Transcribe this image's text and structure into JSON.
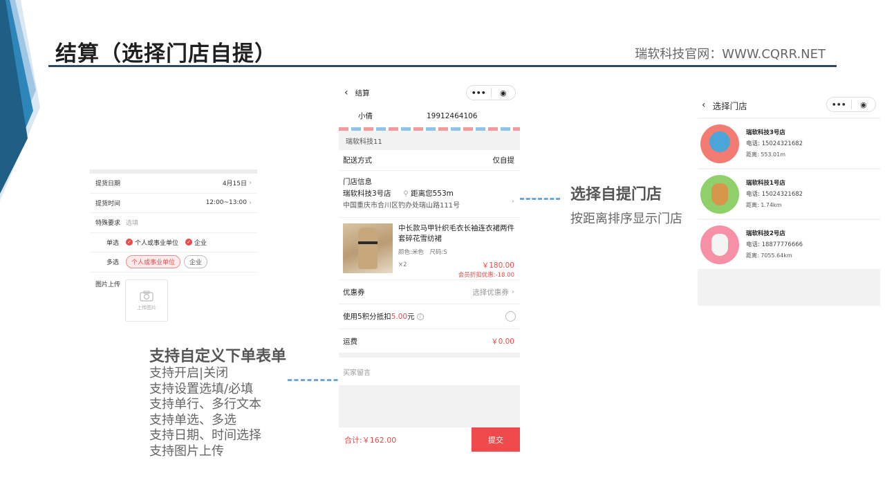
{
  "slide": {
    "title": "结算（选择门店自提）",
    "site": "瑞软科技官网：WWW.CQRR.NET"
  },
  "form": {
    "rows": [
      {
        "label": "提货日期",
        "value": "4月15日"
      },
      {
        "label": "提货时间",
        "value": "12:00~13:00"
      },
      {
        "label": "特殊要求",
        "placeholder": "选填"
      }
    ],
    "single_label": "单选",
    "single_options": [
      "个人或事业单位",
      "企业"
    ],
    "multi_label": "多选",
    "multi_options": [
      "个人或事业单位",
      "企业"
    ],
    "upload_label": "图片上传",
    "upload_hint": "上传图片"
  },
  "features": {
    "heading": "支持自定义下单表单",
    "items": [
      "支持开启|关闭",
      "支持设置选填/必填",
      "支持单行、多行文本",
      "支持单选、多选",
      "支持日期、时间选择",
      "支持图片上传"
    ]
  },
  "checkout": {
    "nav_title": "结算",
    "contact_name": "小倩",
    "contact_phone": "19912464106",
    "shop_name": "瑞软科技11",
    "delivery_label": "配送方式",
    "delivery_value": "仅自提",
    "store_info_label": "门店信息",
    "store_name": "瑞软科技3号店",
    "store_distance": "距离您553m",
    "store_address": "中国重庆市合川区钓办处瑞山路111号",
    "goods_title": "中长款马甲针织毛衣长袖连衣裙两件套碎花雪纺裙",
    "goods_spec": "颜色:米色　尺码:S",
    "goods_qty": "×2",
    "goods_price": "￥180.00",
    "goods_discount": "会员折扣优惠:-18.00",
    "coupon_label": "优惠券",
    "coupon_value": "选择优惠券",
    "points_prefix": "使用5积分抵扣",
    "points_amount": "5.00",
    "points_suffix": "元",
    "shipping_label": "运费",
    "shipping_value": "￥0.00",
    "remark_placeholder": "买家留言",
    "total_label": "合计:",
    "total_value": "￥162.00",
    "submit_label": "提交"
  },
  "store_feature": {
    "heading": "选择自提门店",
    "sub": "按距离排序显示门店"
  },
  "store_list": {
    "nav_title": "选择门店",
    "stores": [
      {
        "name": "瑞软科技3号店",
        "phone": "电话: 15024321682",
        "distance": "距离: 553.01m",
        "color": "#f27b72"
      },
      {
        "name": "瑞软科技1号店",
        "phone": "电话: 15024321682",
        "distance": "距离: 1.74km",
        "color": "#8fd06b"
      },
      {
        "name": "瑞软科技2号店",
        "phone": "电话: 18877776666",
        "distance": "距离: 7055.64km",
        "color": "#f590a6"
      }
    ]
  },
  "colors": {
    "accent_red": "#e94b4b",
    "title_rule": "#2f4a5e",
    "dash_blue": "#6aa8dc"
  },
  "icons": [
    "back-arrow-icon",
    "more-dots-icon",
    "target-circle-icon",
    "chevron-right-icon",
    "location-pin-icon",
    "camera-icon",
    "info-icon",
    "check-icon"
  ]
}
